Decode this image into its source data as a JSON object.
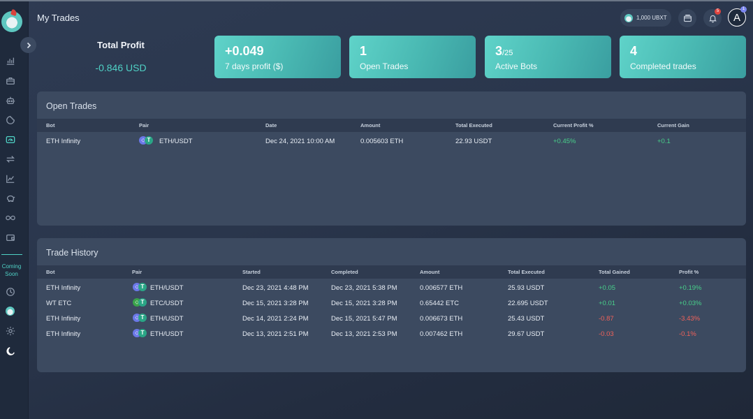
{
  "header": {
    "page_title": "My Trades",
    "balance": "1,000 UBXT",
    "notification_count": "5",
    "avatar_letter": "A",
    "avatar_badge": "1"
  },
  "sidebar": {
    "coming_soon": "Coming Soon",
    "icons": [
      "bar-chart-icon",
      "briefcase-icon",
      "robot-icon",
      "dashboard-icon",
      "exchange-icon",
      "line-chart-icon",
      "piggy-bank-icon",
      "infinity-icon",
      "wallet-icon",
      "clock-icon",
      "coin-icon",
      "sun-icon",
      "moon-icon"
    ]
  },
  "summary": {
    "total_profit_title": "Total Profit",
    "total_profit_value": "-0.846 USD",
    "cards": [
      {
        "value": "+0.049",
        "value_small": "",
        "label": "7 days profit ($)"
      },
      {
        "value": "1",
        "value_small": "",
        "label": "Open Trades"
      },
      {
        "value": "3",
        "value_small": "/25",
        "label": "Active Bots"
      },
      {
        "value": "4",
        "value_small": "",
        "label": "Completed trades"
      }
    ]
  },
  "open_trades": {
    "title": "Open Trades",
    "columns": [
      "Bot",
      "Pair",
      "Date",
      "Amount",
      "Total Executed",
      "Current Profit %",
      "Current Gain"
    ],
    "rows": [
      {
        "bot": "ETH Infinity",
        "pair": "ETH/USDT",
        "base": "ETH",
        "date": "Dec 24, 2021 10:00 AM",
        "amount": "0.005603 ETH",
        "total": "22.93 USDT",
        "profit_pct": "+0.45%",
        "gain": "+0.1"
      }
    ]
  },
  "trade_history": {
    "title": "Trade History",
    "columns": [
      "Bot",
      "Pair",
      "Started",
      "Completed",
      "Amount",
      "Total Executed",
      "Total Gained",
      "Profit %"
    ],
    "rows": [
      {
        "bot": "ETH Infinity",
        "pair": "ETH/USDT",
        "base": "ETH",
        "started": "Dec 23, 2021 4:48 PM",
        "completed": "Dec 23, 2021 5:38 PM",
        "amount": "0.006577 ETH",
        "total": "25.93 USDT",
        "gained": "+0.05",
        "profit": "+0.19%"
      },
      {
        "bot": "WT ETC",
        "pair": "ETC/USDT",
        "base": "ETC",
        "started": "Dec 15, 2021 3:28 PM",
        "completed": "Dec 15, 2021 3:28 PM",
        "amount": "0.65442 ETC",
        "total": "22.695 USDT",
        "gained": "+0.01",
        "profit": "+0.03%"
      },
      {
        "bot": "ETH Infinity",
        "pair": "ETH/USDT",
        "base": "ETH",
        "started": "Dec 14, 2021 2:24 PM",
        "completed": "Dec 15, 2021 5:47 PM",
        "amount": "0.006673 ETH",
        "total": "25.43 USDT",
        "gained": "-0.87",
        "profit": "-3.43%"
      },
      {
        "bot": "ETH Infinity",
        "pair": "ETH/USDT",
        "base": "ETH",
        "started": "Dec 13, 2021 2:51 PM",
        "completed": "Dec 13, 2021 2:53 PM",
        "amount": "0.007462 ETH",
        "total": "29.67 USDT",
        "gained": "-0.03",
        "profit": "-0.1%"
      }
    ]
  },
  "colors": {
    "accent": "#4fd1c5",
    "positive": "#48d08a",
    "negative": "#f0625a",
    "panel": "#3c4a60",
    "sidebar": "#1f2a3c"
  }
}
